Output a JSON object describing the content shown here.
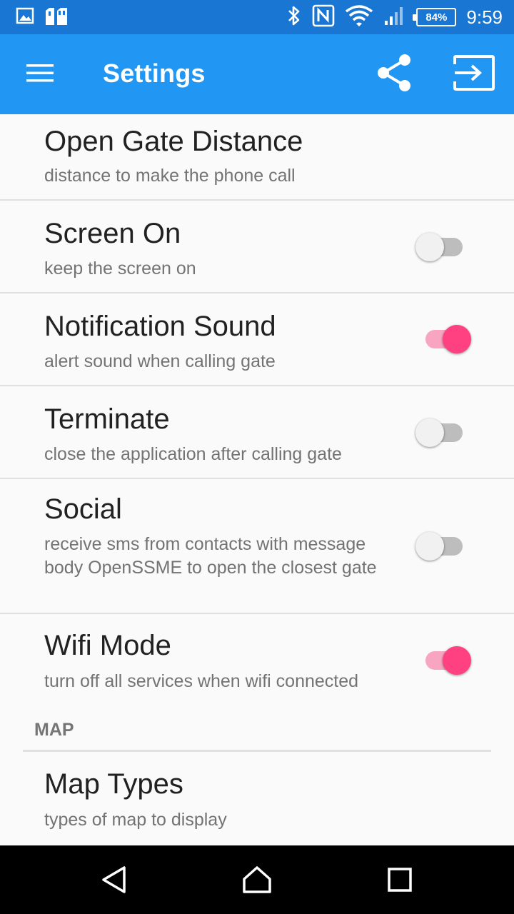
{
  "status_bar": {
    "time": "9:59",
    "battery": "84%",
    "icons": [
      "gallery-icon",
      "storage-card-icon",
      "bluetooth-icon",
      "nfc-icon",
      "wifi-icon",
      "signal-icon",
      "battery-icon"
    ]
  },
  "app_bar": {
    "title": "Settings",
    "color": "#2196f3",
    "icons": [
      "menu-icon",
      "share-icon",
      "exit-icon"
    ]
  },
  "preferences": [
    {
      "title": "Open Gate Distance",
      "summary": "distance to make the phone call"
    },
    {
      "title": "Screen On",
      "summary": "keep the screen on",
      "checked": false
    },
    {
      "title": "Notification Sound",
      "summary": "alert sound when calling gate",
      "checked": true
    },
    {
      "title": "Terminate",
      "summary": "close the application after calling gate",
      "checked": false
    },
    {
      "title": "Social",
      "summary": "receive sms from contacts with message body OpenSSME to open the closest gate",
      "checked": false
    },
    {
      "title": "Wifi Mode",
      "summary": "turn off all services when wifi connected",
      "checked": true
    }
  ],
  "map_category": {
    "label": "MAP",
    "items": [
      {
        "title": "Map Types",
        "summary": "types of map to display"
      }
    ]
  },
  "accent_color": "#ff4081",
  "nav_bar": {
    "icons": [
      "back-icon",
      "home-icon",
      "recent-apps-icon"
    ]
  }
}
